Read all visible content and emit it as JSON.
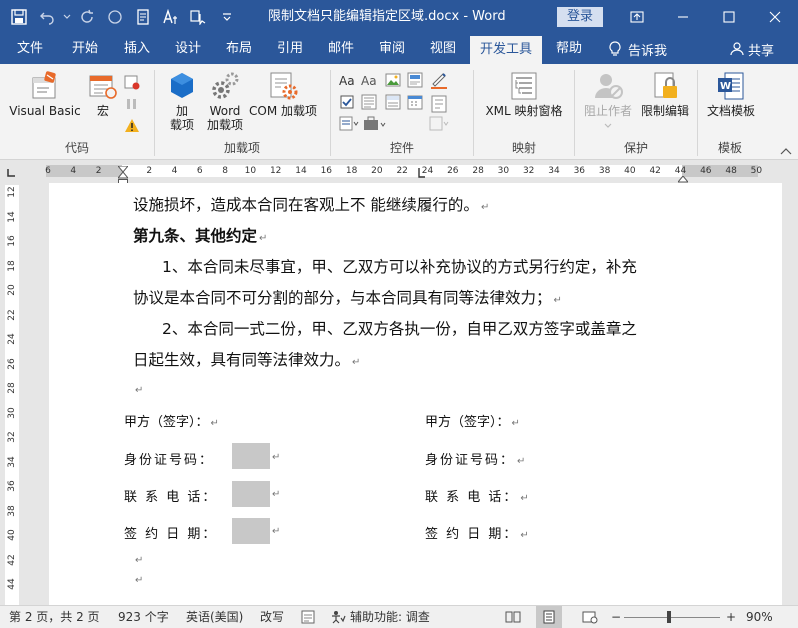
{
  "app": {
    "doc_title": "限制文档只能编辑指定区域.docx",
    "app_name": "Word",
    "title_separator": " - ",
    "login_label": "登录"
  },
  "tabs": [
    {
      "label": "文件",
      "active": false
    },
    {
      "label": "开始",
      "active": false
    },
    {
      "label": "插入",
      "active": false
    },
    {
      "label": "设计",
      "active": false
    },
    {
      "label": "布局",
      "active": false
    },
    {
      "label": "引用",
      "active": false
    },
    {
      "label": "邮件",
      "active": false
    },
    {
      "label": "审阅",
      "active": false
    },
    {
      "label": "视图",
      "active": false
    },
    {
      "label": "开发工具",
      "active": true
    },
    {
      "label": "帮助",
      "active": false
    }
  ],
  "tell_me": "告诉我",
  "share": "共享",
  "ribbon": {
    "code": {
      "group_label": "代码",
      "visual_basic": "Visual Basic",
      "macro": "宏"
    },
    "addins": {
      "group_label": "加载项",
      "addin_line1": "加",
      "addin_line2": "载项",
      "word_addin_line1": "Word",
      "word_addin_line2": "加载项",
      "com_addin": "COM 加载项"
    },
    "controls": {
      "group_label": "控件"
    },
    "mapping": {
      "group_label": "映射",
      "xml_pane": "XML 映射窗格"
    },
    "protect": {
      "group_label": "保护",
      "block_authors": "阻止作者",
      "restrict_editing": "限制编辑"
    },
    "templates": {
      "group_label": "模板",
      "doc_template": "文档模板"
    }
  },
  "ruler": {
    "h_ticks": [
      "6",
      "4",
      "2",
      "",
      "2",
      "4",
      "6",
      "8",
      "10",
      "12",
      "14",
      "16",
      "18",
      "20",
      "22",
      "24",
      "26",
      "28",
      "30",
      "32",
      "34",
      "36",
      "38",
      "40",
      "42",
      "44",
      "46",
      "48",
      "50"
    ],
    "v_ticks": [
      "12",
      "14",
      "16",
      "18",
      "20",
      "22",
      "24",
      "26",
      "28",
      "30",
      "32",
      "34",
      "36",
      "38",
      "40",
      "42",
      "44"
    ]
  },
  "document": {
    "line1": "设施损坏，造成本合同在客观上不 能继续履行的。",
    "heading9": "第九条、其他约定",
    "p1_line1": "1、本合同未尽事宜，甲、乙双方可以补充协议的方式另行约定，补充",
    "p1_line2": "协议是本合同不可分割的部分，与本合同具有同等法律效力；",
    "p2_line1": "2、本合同一式二份，甲、乙双方各执一份，自甲乙双方签字或盖章之",
    "p2_line2": "日起生效，具有同等法律效力。",
    "para_mark": "↵",
    "form": {
      "left": {
        "sign": "甲方（签字）：",
        "id": "身份证号码：",
        "phone": "联 系 电 话：",
        "date": "签 约 日 期："
      },
      "right": {
        "sign": "甲方（签字）：",
        "id": "身份证号码：",
        "phone": "联 系 电 话：",
        "date": "签 约 日 期："
      }
    }
  },
  "status": {
    "page": "第 2 页，共 2 页",
    "words": "923 个字",
    "lang": "英语(美国)",
    "track": "改写",
    "accessibility": "辅助功能: 调查",
    "zoom": "90%",
    "zoom_minus": "−",
    "zoom_plus": "+"
  },
  "colors": {
    "brand": "#2b579a",
    "ribbon_bg": "#f3f3f3",
    "editable_shade": "#c8c8c8"
  }
}
